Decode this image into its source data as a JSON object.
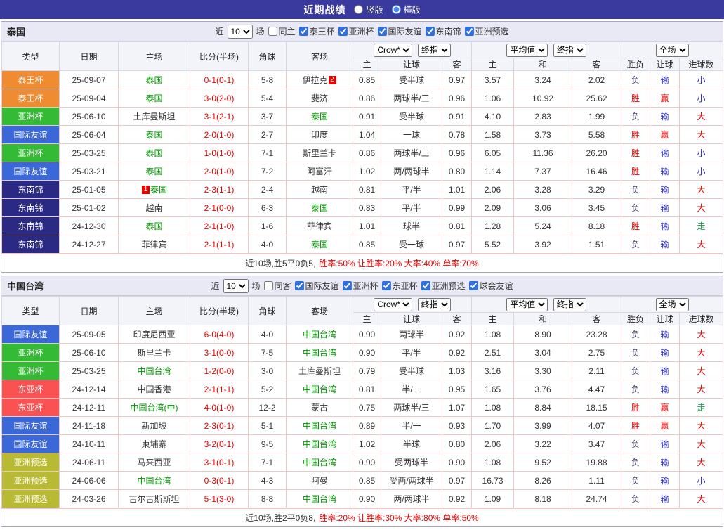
{
  "topbar": {
    "title": "近期战绩",
    "options": [
      {
        "label": "竖版",
        "selected": false
      },
      {
        "label": "横版",
        "selected": true
      }
    ]
  },
  "colors": {
    "type": {
      "泰王杯": "#ef8b31",
      "亚洲杯": "#35ba35",
      "国际友谊": "#3b68d8",
      "东南锦": "#2a2a85",
      "东亚杯": "#fa5252",
      "亚洲预选": "#b9ba33"
    },
    "result": {
      "胜": "#e80000",
      "负": "#444466",
      "赢": "#e80000",
      "输": "#2a2ac8",
      "大": "#e80000",
      "小": "#2a2ac8",
      "走": "#1e9e50"
    },
    "focus_team": "#009500",
    "score": "#e80000"
  },
  "tables": [
    {
      "team": "泰国",
      "filter": {
        "near": "近",
        "count": "10",
        "unit": "场",
        "same": {
          "label": "同主",
          "checked": false
        },
        "leagues": [
          {
            "label": "泰王杯",
            "checked": true
          },
          {
            "label": "亚洲杯",
            "checked": true
          },
          {
            "label": "国际友谊",
            "checked": true
          },
          {
            "label": "东南锦",
            "checked": true
          },
          {
            "label": "亚洲预选",
            "checked": true
          }
        ]
      },
      "header": {
        "cols": [
          "类型",
          "日期",
          "主场",
          "比分(半场)",
          "角球",
          "客场"
        ],
        "company_select": "Crow*",
        "final_select_1": "终指",
        "avg_select": "平均值",
        "final_select_2": "终指",
        "scope_select": "全场",
        "sub": [
          "主",
          "让球",
          "客",
          "主",
          "和",
          "客",
          "胜负",
          "让球",
          "进球数"
        ]
      },
      "rows": [
        {
          "type": "泰王杯",
          "date": "25-09-07",
          "home": {
            "name": "泰国",
            "focus": true
          },
          "score": "0-1(0-1)",
          "corner": "5-8",
          "away": {
            "name": "伊拉克",
            "badge_post": "2"
          },
          "odds": [
            "0.85",
            "受半球",
            "0.97"
          ],
          "avg": [
            "3.57",
            "3.24",
            "2.02"
          ],
          "results": [
            "负",
            "输",
            "小"
          ]
        },
        {
          "type": "泰王杯",
          "date": "25-09-04",
          "home": {
            "name": "泰国",
            "focus": true
          },
          "score": "3-0(2-0)",
          "corner": "5-4",
          "away": {
            "name": "斐济"
          },
          "odds": [
            "0.86",
            "两球半/三",
            "0.96"
          ],
          "avg": [
            "1.06",
            "10.92",
            "25.62"
          ],
          "results": [
            "胜",
            "赢",
            "小"
          ]
        },
        {
          "type": "亚洲杯",
          "date": "25-06-10",
          "home": {
            "name": "土库曼斯坦"
          },
          "score": "3-1(2-1)",
          "corner": "3-7",
          "away": {
            "name": "泰国",
            "focus": true
          },
          "odds": [
            "0.91",
            "受半球",
            "0.91"
          ],
          "avg": [
            "4.10",
            "2.83",
            "1.99"
          ],
          "results": [
            "负",
            "输",
            "大"
          ]
        },
        {
          "type": "国际友谊",
          "date": "25-06-04",
          "home": {
            "name": "泰国",
            "focus": true
          },
          "score": "2-0(1-0)",
          "corner": "2-7",
          "away": {
            "name": "印度"
          },
          "odds": [
            "1.04",
            "一球",
            "0.78"
          ],
          "avg": [
            "1.58",
            "3.73",
            "5.58"
          ],
          "results": [
            "胜",
            "赢",
            "大"
          ]
        },
        {
          "type": "亚洲杯",
          "date": "25-03-25",
          "home": {
            "name": "泰国",
            "focus": true
          },
          "score": "1-0(1-0)",
          "corner": "7-1",
          "away": {
            "name": "斯里兰卡"
          },
          "odds": [
            "0.86",
            "两球半/三",
            "0.96"
          ],
          "avg": [
            "6.05",
            "11.36",
            "26.20"
          ],
          "results": [
            "胜",
            "输",
            "小"
          ]
        },
        {
          "type": "国际友谊",
          "date": "25-03-21",
          "home": {
            "name": "泰国",
            "focus": true
          },
          "score": "2-0(1-0)",
          "corner": "7-2",
          "away": {
            "name": "阿富汗"
          },
          "odds": [
            "1.02",
            "两/两球半",
            "0.80"
          ],
          "avg": [
            "1.14",
            "7.37",
            "16.46"
          ],
          "results": [
            "胜",
            "输",
            "小"
          ]
        },
        {
          "type": "东南锦",
          "date": "25-01-05",
          "home": {
            "name": "泰国",
            "focus": true,
            "badge_pre": "1"
          },
          "score": "2-3(1-1)",
          "corner": "2-4",
          "away": {
            "name": "越南"
          },
          "odds": [
            "0.81",
            "平/半",
            "1.01"
          ],
          "avg": [
            "2.06",
            "3.28",
            "3.29"
          ],
          "results": [
            "负",
            "输",
            "大"
          ]
        },
        {
          "type": "东南锦",
          "date": "25-01-02",
          "home": {
            "name": "越南"
          },
          "score": "2-1(0-0)",
          "corner": "6-3",
          "away": {
            "name": "泰国",
            "focus": true
          },
          "odds": [
            "0.83",
            "平/半",
            "0.99"
          ],
          "avg": [
            "2.09",
            "3.06",
            "3.45"
          ],
          "results": [
            "负",
            "输",
            "大"
          ]
        },
        {
          "type": "东南锦",
          "date": "24-12-30",
          "home": {
            "name": "泰国",
            "focus": true
          },
          "score": "2-1(1-0)",
          "corner": "1-6",
          "away": {
            "name": "菲律宾"
          },
          "odds": [
            "1.01",
            "球半",
            "0.81"
          ],
          "avg": [
            "1.28",
            "5.24",
            "8.18"
          ],
          "results": [
            "胜",
            "输",
            "走"
          ]
        },
        {
          "type": "东南锦",
          "date": "24-12-27",
          "home": {
            "name": "菲律宾"
          },
          "score": "2-1(1-1)",
          "corner": "4-0",
          "away": {
            "name": "泰国",
            "focus": true
          },
          "odds": [
            "0.85",
            "受一球",
            "0.97"
          ],
          "avg": [
            "5.52",
            "3.92",
            "1.51"
          ],
          "results": [
            "负",
            "输",
            "大"
          ]
        }
      ],
      "summary": {
        "prefix": "近10场,胜5平0负5,",
        "stats": "胜率:50% 让胜率:20% 大率:40% 单率:70%"
      }
    },
    {
      "team": "中国台湾",
      "filter": {
        "near": "近",
        "count": "10",
        "unit": "场",
        "same": {
          "label": "同客",
          "checked": false
        },
        "leagues": [
          {
            "label": "国际友谊",
            "checked": true
          },
          {
            "label": "亚洲杯",
            "checked": true
          },
          {
            "label": "东亚杯",
            "checked": true
          },
          {
            "label": "亚洲预选",
            "checked": true
          },
          {
            "label": "球会友谊",
            "checked": true
          }
        ]
      },
      "header": {
        "cols": [
          "类型",
          "日期",
          "主场",
          "比分(半场)",
          "角球",
          "客场"
        ],
        "company_select": "Crow*",
        "final_select_1": "终指",
        "avg_select": "平均值",
        "final_select_2": "终指",
        "scope_select": "全场",
        "sub": [
          "主",
          "让球",
          "客",
          "主",
          "和",
          "客",
          "胜负",
          "让球",
          "进球数"
        ]
      },
      "rows": [
        {
          "type": "国际友谊",
          "date": "25-09-05",
          "home": {
            "name": "印度尼西亚"
          },
          "score": "6-0(4-0)",
          "corner": "4-0",
          "away": {
            "name": "中国台湾",
            "focus": true
          },
          "odds": [
            "0.90",
            "两球半",
            "0.92"
          ],
          "avg": [
            "1.08",
            "8.90",
            "23.28"
          ],
          "results": [
            "负",
            "输",
            "大"
          ]
        },
        {
          "type": "亚洲杯",
          "date": "25-06-10",
          "home": {
            "name": "斯里兰卡"
          },
          "score": "3-1(0-0)",
          "corner": "7-5",
          "away": {
            "name": "中国台湾",
            "focus": true
          },
          "odds": [
            "0.90",
            "平/半",
            "0.92"
          ],
          "avg": [
            "2.51",
            "3.04",
            "2.75"
          ],
          "results": [
            "负",
            "输",
            "大"
          ]
        },
        {
          "type": "亚洲杯",
          "date": "25-03-25",
          "home": {
            "name": "中国台湾",
            "focus": true
          },
          "score": "1-2(0-0)",
          "corner": "3-0",
          "away": {
            "name": "土库曼斯坦"
          },
          "odds": [
            "0.79",
            "受半球",
            "1.03"
          ],
          "avg": [
            "3.16",
            "3.30",
            "2.11"
          ],
          "results": [
            "负",
            "输",
            "大"
          ]
        },
        {
          "type": "东亚杯",
          "date": "24-12-14",
          "home": {
            "name": "中国香港"
          },
          "score": "2-1(1-1)",
          "corner": "5-2",
          "away": {
            "name": "中国台湾",
            "focus": true
          },
          "odds": [
            "0.81",
            "半/一",
            "0.95"
          ],
          "avg": [
            "1.65",
            "3.76",
            "4.47"
          ],
          "results": [
            "负",
            "输",
            "大"
          ]
        },
        {
          "type": "东亚杯",
          "date": "24-12-11",
          "home": {
            "name": "中国台湾(中)",
            "focus": true
          },
          "score": "4-0(1-0)",
          "corner": "12-2",
          "away": {
            "name": "蒙古"
          },
          "odds": [
            "0.75",
            "两球半/三",
            "1.07"
          ],
          "avg": [
            "1.08",
            "8.84",
            "18.15"
          ],
          "results": [
            "胜",
            "赢",
            "走"
          ]
        },
        {
          "type": "国际友谊",
          "date": "24-11-18",
          "home": {
            "name": "新加坡"
          },
          "score": "2-3(0-1)",
          "corner": "5-1",
          "away": {
            "name": "中国台湾",
            "focus": true
          },
          "odds": [
            "0.89",
            "半/一",
            "0.93"
          ],
          "avg": [
            "1.70",
            "3.99",
            "4.07"
          ],
          "results": [
            "胜",
            "赢",
            "大"
          ]
        },
        {
          "type": "国际友谊",
          "date": "24-10-11",
          "home": {
            "name": "柬埔寨"
          },
          "score": "3-2(0-1)",
          "corner": "9-5",
          "away": {
            "name": "中国台湾",
            "focus": true
          },
          "odds": [
            "1.02",
            "半球",
            "0.80"
          ],
          "avg": [
            "2.06",
            "3.22",
            "3.47"
          ],
          "results": [
            "负",
            "输",
            "大"
          ]
        },
        {
          "type": "亚洲预选",
          "date": "24-06-11",
          "home": {
            "name": "马来西亚"
          },
          "score": "3-1(0-1)",
          "corner": "7-1",
          "away": {
            "name": "中国台湾",
            "focus": true
          },
          "odds": [
            "0.90",
            "受两球半",
            "0.90"
          ],
          "avg": [
            "1.08",
            "9.52",
            "19.88"
          ],
          "results": [
            "负",
            "输",
            "大"
          ]
        },
        {
          "type": "亚洲预选",
          "date": "24-06-06",
          "home": {
            "name": "中国台湾",
            "focus": true
          },
          "score": "0-3(0-1)",
          "corner": "4-3",
          "away": {
            "name": "阿曼"
          },
          "odds": [
            "0.85",
            "受两/两球半",
            "0.97"
          ],
          "avg": [
            "16.73",
            "8.26",
            "1.11"
          ],
          "results": [
            "负",
            "输",
            "小"
          ]
        },
        {
          "type": "亚洲预选",
          "date": "24-03-26",
          "home": {
            "name": "吉尔吉斯斯坦"
          },
          "score": "5-1(3-0)",
          "corner": "8-8",
          "away": {
            "name": "中国台湾",
            "focus": true
          },
          "odds": [
            "0.90",
            "两/两球半",
            "0.92"
          ],
          "avg": [
            "1.09",
            "8.18",
            "24.74"
          ],
          "results": [
            "负",
            "输",
            "大"
          ]
        }
      ],
      "summary": {
        "prefix": "近10场,胜2平0负8,",
        "stats": "胜率:20% 让胜率:30% 大率:80% 单率:50%"
      }
    }
  ]
}
